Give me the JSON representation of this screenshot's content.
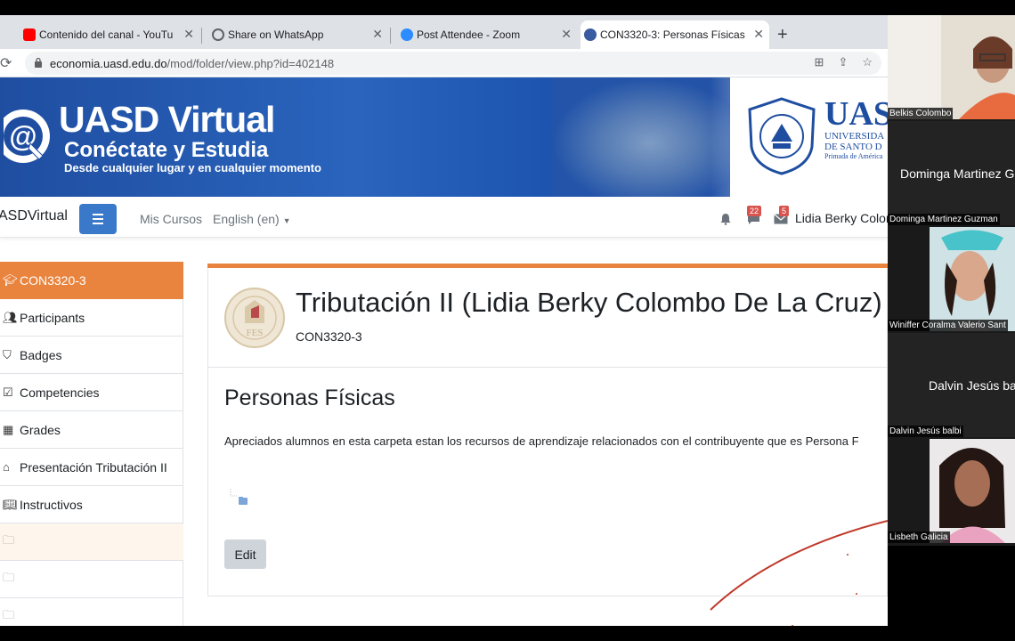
{
  "browser": {
    "tabs": [
      {
        "title": "Contenido del canal - YouTube",
        "icon": "youtube-icon",
        "icon_color": "#ff0000"
      },
      {
        "title": "Share on WhatsApp",
        "icon": "globe-icon",
        "icon_color": "#5f6368"
      },
      {
        "title": "Post Attendee - Zoom",
        "icon": "zoom-icon",
        "icon_color": "#2d8cff"
      },
      {
        "title": "CON3320-3: Personas Físicas",
        "icon": "uasd-icon",
        "icon_color": "#3a5ba0"
      }
    ],
    "url_host": "economia.uasd.edu.do",
    "url_path": "/mod/folder/view.php?id=402148"
  },
  "banner": {
    "title": "UASD Virtual",
    "subtitle": "Conéctate y Estudia",
    "tagline": "Desde cualquier lugar y en cualquier momento",
    "university_big": "UAS",
    "university_line1": "UNIVERSIDA",
    "university_line2": "DE SANTO D",
    "university_line3": "Primada de América"
  },
  "navbar": {
    "brand": "ASDVirtual",
    "links": [
      "Mis Cursos",
      "English (en)"
    ],
    "notifications_count": "22",
    "messages_count": "5",
    "user_name": "Lidia Berky Colon"
  },
  "sidebar": {
    "items": [
      {
        "label": "CON3320-3",
        "icon": "graduation-cap-icon"
      },
      {
        "label": "Participants",
        "icon": "users-icon"
      },
      {
        "label": "Badges",
        "icon": "shield-icon"
      },
      {
        "label": "Competencies",
        "icon": "checkbox-icon"
      },
      {
        "label": "Grades",
        "icon": "table-icon"
      },
      {
        "label": "Presentación Tributación II",
        "icon": "home-icon"
      },
      {
        "label": "Instructivos",
        "icon": "book-icon"
      },
      {
        "label": "",
        "icon": "folder-icon"
      },
      {
        "label": "",
        "icon": "folder-icon"
      },
      {
        "label": "",
        "icon": "folder-icon"
      }
    ]
  },
  "course": {
    "title": "Tributación II (Lidia Berky Colombo De La Cruz)",
    "code": "CON3320-3"
  },
  "folder": {
    "title": "Personas Físicas",
    "description": "Apreciados alumnos en esta carpeta estan los recursos de aprendizaje relacionados con el contribuyente que es Persona F",
    "edit_label": "Edit"
  },
  "zoom": {
    "participants": [
      {
        "name": "Belkis Colombo",
        "big_label": "",
        "video": true
      },
      {
        "name": "Dominga Martinez Guzman",
        "big_label": "Dominga Martinez G",
        "video": false
      },
      {
        "name": "Winiffer Coralma Valerio Sant",
        "big_label": "",
        "video": true
      },
      {
        "name": "Dalvin Jesús balbi",
        "big_label": "Dalvin Jesús ba",
        "video": false
      },
      {
        "name": "Lisbeth Galicia",
        "big_label": "",
        "video": true
      }
    ]
  },
  "colors": {
    "accent": "#e9843f",
    "primary_button": "#3a78c9",
    "banner_blue": "#1f4ea1"
  }
}
